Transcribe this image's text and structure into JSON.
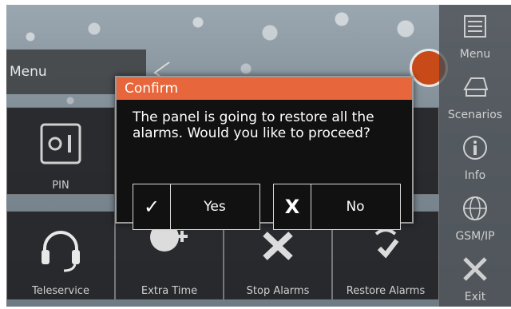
{
  "header": {
    "menu_label": "Menu"
  },
  "sidebar": {
    "items": [
      {
        "label": "Menu",
        "icon": "list-icon"
      },
      {
        "label": "Scenarios",
        "icon": "scenarios-icon"
      },
      {
        "label": "Info",
        "icon": "info-icon"
      },
      {
        "label": "GSM/IP",
        "icon": "globe-icon"
      },
      {
        "label": "Exit",
        "icon": "exit-icon"
      }
    ]
  },
  "tiles": {
    "row1": [
      {
        "label": "PIN",
        "icon": "safe-icon"
      }
    ],
    "row2": [
      {
        "label": "Teleservice",
        "icon": "headset-icon"
      },
      {
        "label": "Extra Time",
        "icon": "clock-plus-icon"
      },
      {
        "label": "Stop Alarms",
        "icon": "stop-alarm-icon"
      },
      {
        "label": "Restore Alarms",
        "icon": "restore-alarm-icon"
      }
    ]
  },
  "dialog": {
    "title": "Confirm",
    "message": "The panel is going to restore all the alarms.  Would you like to proceed?",
    "yes_symbol": "✓",
    "yes_label": "Yes",
    "no_symbol": "X",
    "no_label": "No"
  },
  "colors": {
    "accent": "#e8663b",
    "logo": "#c84a18",
    "dialog_bg": "#111111"
  }
}
